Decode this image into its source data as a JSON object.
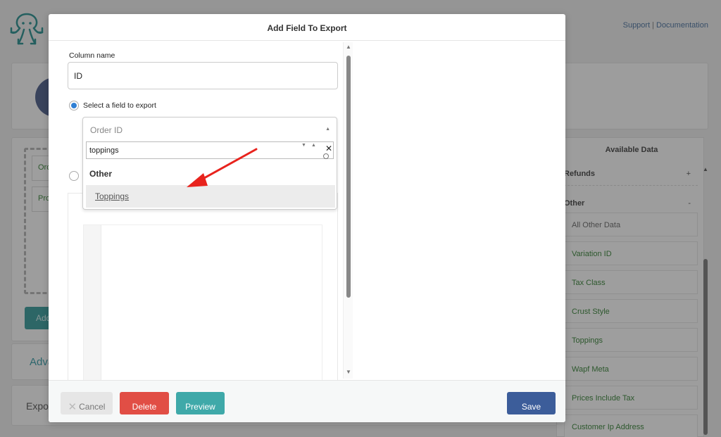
{
  "header": {
    "links": [
      "Support",
      "Documentation"
    ]
  },
  "background": {
    "field_items": [
      "Order ID",
      "Product"
    ],
    "add_button": "Add",
    "advanced_label": "Advanced",
    "export_label": "Export",
    "available_data": {
      "title": "Available Data",
      "groups": [
        {
          "label": "Refunds",
          "toggle": "+"
        },
        {
          "label": "Other",
          "toggle": "-"
        }
      ],
      "items": [
        {
          "label": "All Other Data",
          "muted": true
        },
        {
          "label": "Variation ID"
        },
        {
          "label": "Tax Class"
        },
        {
          "label": "Crust Style"
        },
        {
          "label": "Toppings"
        },
        {
          "label": "Wapf Meta"
        },
        {
          "label": "Prices Include Tax"
        },
        {
          "label": "Customer Ip Address"
        }
      ]
    }
  },
  "modal": {
    "title": "Add Field To Export",
    "column_name_label": "Column name",
    "column_name_value": "ID",
    "radio_select_label": "Select a field to export",
    "radio_select_checked": true,
    "radio_custom_checked": false,
    "select": {
      "current": "Order ID",
      "search_value": "toppings",
      "group_label": "Other",
      "options": [
        "Toppings"
      ]
    },
    "footer": {
      "cancel": "Cancel",
      "delete": "Delete",
      "preview": "Preview",
      "save": "Save"
    }
  },
  "colors": {
    "delete": "#e14e45",
    "preview": "#3fa9a9",
    "save": "#3c5d9a",
    "radio_on": "#2f7fd4",
    "annotation_arrow": "#e8231d"
  }
}
